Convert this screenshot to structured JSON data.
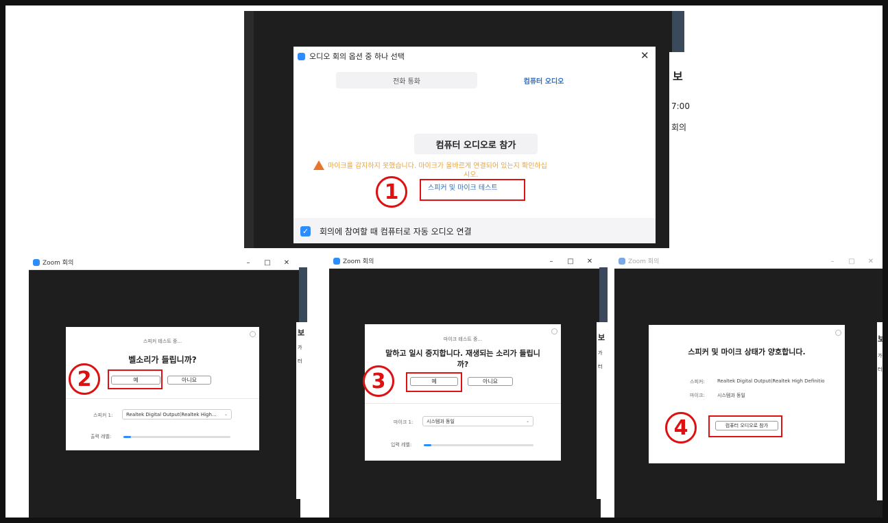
{
  "top": {
    "title": "오디오 회의 옵션 중 하나 선택",
    "tab_phone": "전화 통화",
    "tab_computer": "컴퓨터 오디오",
    "join_button": "컴퓨터 오디오로 참가",
    "warning_line1": "마이크를 감지하지 못했습니다. 마이크가 올바르게 연결되어 있는지 확인하십",
    "warning_line2": "시오.",
    "test_link": "스피커 및 마이크 테스트",
    "auto_connect": "회의에 참여할 때 컴퓨터로 자동 오디오 연결",
    "auto_connect_checked": true,
    "bg_text": [
      "보",
      "7:00",
      "회의"
    ]
  },
  "step1": {
    "number": "1"
  },
  "win2": {
    "title": "Zoom 회의",
    "subtitle": "스피커 테스트 중...",
    "question": "벨소리가 들립니까?",
    "yes": "예",
    "no": "아니요",
    "speaker_label": "스피커 1:",
    "speaker_value": "Realtek Digital Output(Realtek High...",
    "level_label": "출력 레벨:",
    "level": 0.07,
    "number": "2",
    "bg_text": [
      "보",
      "가",
      "터"
    ]
  },
  "win3": {
    "title": "Zoom 회의",
    "subtitle": "마이크 테스트 중...",
    "question_line1": "말하고 일시 중지합니다. 재생되는 소리가 들립니",
    "question_line2": "까?",
    "yes": "예",
    "no": "아니요",
    "mic_label": "마이크 1:",
    "mic_value": "시스템과 동일",
    "level_label": "입력 레벨:",
    "level": 0.07,
    "number": "3",
    "bg_text": [
      "보",
      "가",
      "터"
    ]
  },
  "win4": {
    "title": "Zoom 회의",
    "message": "스피커 및 마이크 상태가 양호합니다.",
    "speaker_label": "스피커:",
    "speaker_value": "Realtek Digital Output(Realtek High Definitio",
    "mic_label": "마이크:",
    "mic_value": "시스템과 동일",
    "join_button": "컴퓨터 오디오로 참가",
    "number": "4",
    "bg_text": [
      "보",
      "가",
      "터"
    ]
  },
  "window_controls": {
    "min": "–",
    "max": "□",
    "close": "✕"
  },
  "colors": {
    "accent": "#2d8cff",
    "warning": "#e8a33a",
    "highlight": "#d11111",
    "dark_bg": "#1e1e1e"
  }
}
